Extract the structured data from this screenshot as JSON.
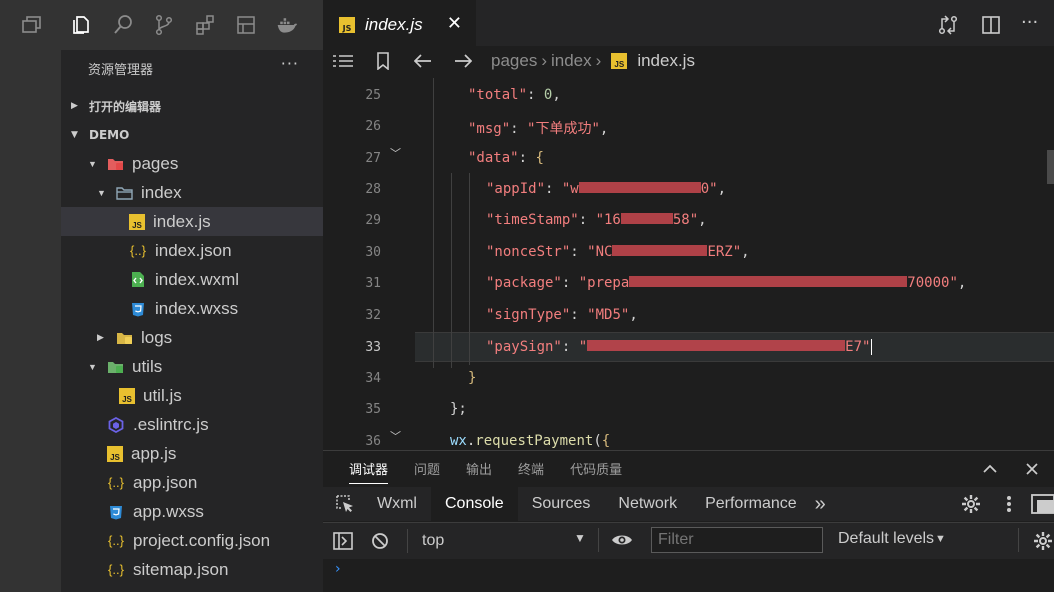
{
  "sidebar": {
    "title": "资源管理器",
    "more": "···",
    "open_editors": "打开的编辑器",
    "project": "DEMO",
    "tree": [
      {
        "label": "pages",
        "type": "folder-red",
        "arrow": "▼",
        "indent": 1
      },
      {
        "label": "index",
        "type": "folder",
        "arrow": "▼",
        "indent": 2
      },
      {
        "label": "index.js",
        "type": "js",
        "arrow": "",
        "indent": 3,
        "selected": true
      },
      {
        "label": "index.json",
        "type": "json",
        "arrow": "",
        "indent": 3
      },
      {
        "label": "index.wxml",
        "type": "wxml",
        "arrow": "",
        "indent": 3
      },
      {
        "label": "index.wxss",
        "type": "wxss",
        "arrow": "",
        "indent": 3
      },
      {
        "label": "logs",
        "type": "folder-yellow",
        "arrow": "▶",
        "indent": 2
      },
      {
        "label": "utils",
        "type": "folder-green",
        "arrow": "▼",
        "indent": 1
      },
      {
        "label": "util.js",
        "type": "js",
        "arrow": "",
        "indent": 2
      },
      {
        "label": ".eslintrc.js",
        "type": "eslint",
        "arrow": "",
        "indent": 1
      },
      {
        "label": "app.js",
        "type": "js",
        "arrow": "",
        "indent": 1
      },
      {
        "label": "app.json",
        "type": "json",
        "arrow": "",
        "indent": 1
      },
      {
        "label": "app.wxss",
        "type": "wxss",
        "arrow": "",
        "indent": 1
      },
      {
        "label": "project.config.json",
        "type": "json",
        "arrow": "",
        "indent": 1
      },
      {
        "label": "sitemap.json",
        "type": "json",
        "arrow": "",
        "indent": 1
      }
    ]
  },
  "editor": {
    "tab_label": "index.js",
    "tab_close": "✕",
    "js_badge": "JS",
    "json_glyph": "{..}",
    "breadcrumbs": [
      "pages",
      "index",
      "index.js"
    ],
    "line_numbers": [
      "25",
      "26",
      "27",
      "28",
      "29",
      "30",
      "31",
      "32",
      "33",
      "34",
      "35",
      "36"
    ],
    "current_line": "33",
    "code": {
      "l25_key": "\"total\"",
      "l25_val": "0",
      "l26_key": "\"msg\"",
      "l26_val": "\"下单成功\"",
      "l27_key": "\"data\"",
      "l28_key": "\"appId\"",
      "l28_a": "\"w",
      "l28_b": "0\"",
      "l29_key": "\"timeStamp\"",
      "l29_a": "\"16",
      "l29_b": "58\"",
      "l30_key": "\"nonceStr\"",
      "l30_a": "\"NC",
      "l30_b": "ERZ\"",
      "l31_key": "\"package\"",
      "l31_a": "\"prepa",
      "l31_b": "70000\"",
      "l32_key": "\"signType\"",
      "l32_val": "\"MD5\"",
      "l33_key": "\"paySign\"",
      "l33_a": "\"",
      "l33_b": "E7\"",
      "l36_obj": "wx",
      "l36_fn": "requestPayment"
    }
  },
  "panel": {
    "tabs": [
      "调试器",
      "问题",
      "输出",
      "终端",
      "代码质量"
    ],
    "devtools_tabs": [
      "Wxml",
      "Console",
      "Sources",
      "Network",
      "Performance"
    ],
    "more_tabs": "»",
    "context": "top",
    "filter_placeholder": "Filter",
    "levels": "Default levels",
    "prompt": "›"
  }
}
